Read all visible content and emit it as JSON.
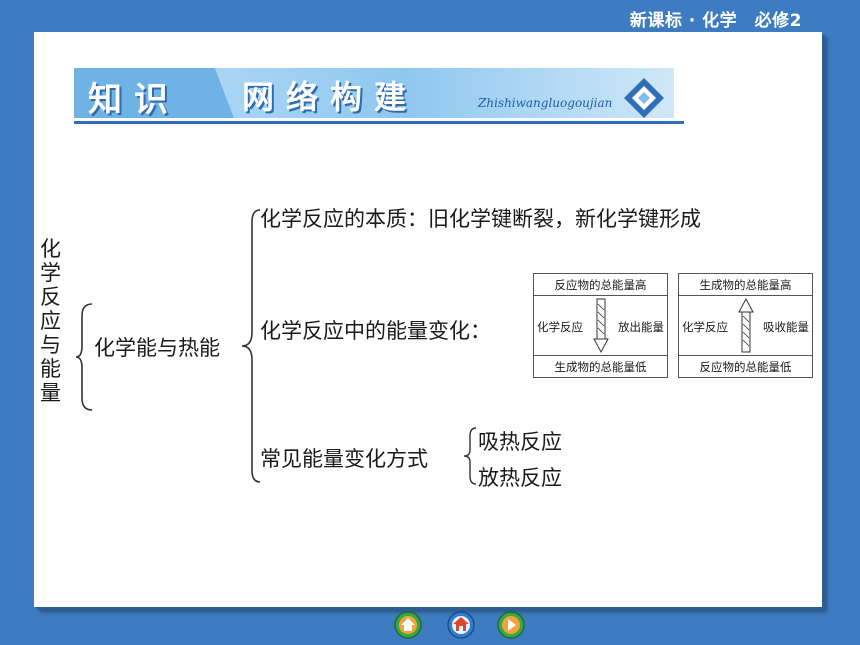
{
  "header": {
    "course": "新课标 · 化学　必修2"
  },
  "banner": {
    "title1": "知识",
    "title2": "网络构建",
    "pinyin": "Zhishiwangluogoujian"
  },
  "diagram": {
    "root": "化学反应与能量",
    "level1": "化学能与热能",
    "items": {
      "essence": "化学反应的本质：旧化学键断裂，新化学键形成",
      "energy_change": "化学反应中的能量变化：",
      "common_ways": "常见能量变化方式",
      "endothermic": "吸热反应",
      "exothermic": "放热反应"
    },
    "box_release": {
      "top": "反应物的总能量高",
      "left": "化学反应",
      "right": "放出能量",
      "bottom": "生成物的总能量低"
    },
    "box_absorb": {
      "top": "生成物的总能量高",
      "left": "化学反应",
      "right": "吸收能量",
      "bottom": "反应物的总能量低"
    }
  },
  "nav": {
    "items": [
      "home-icon",
      "house-icon",
      "next-icon"
    ]
  }
}
